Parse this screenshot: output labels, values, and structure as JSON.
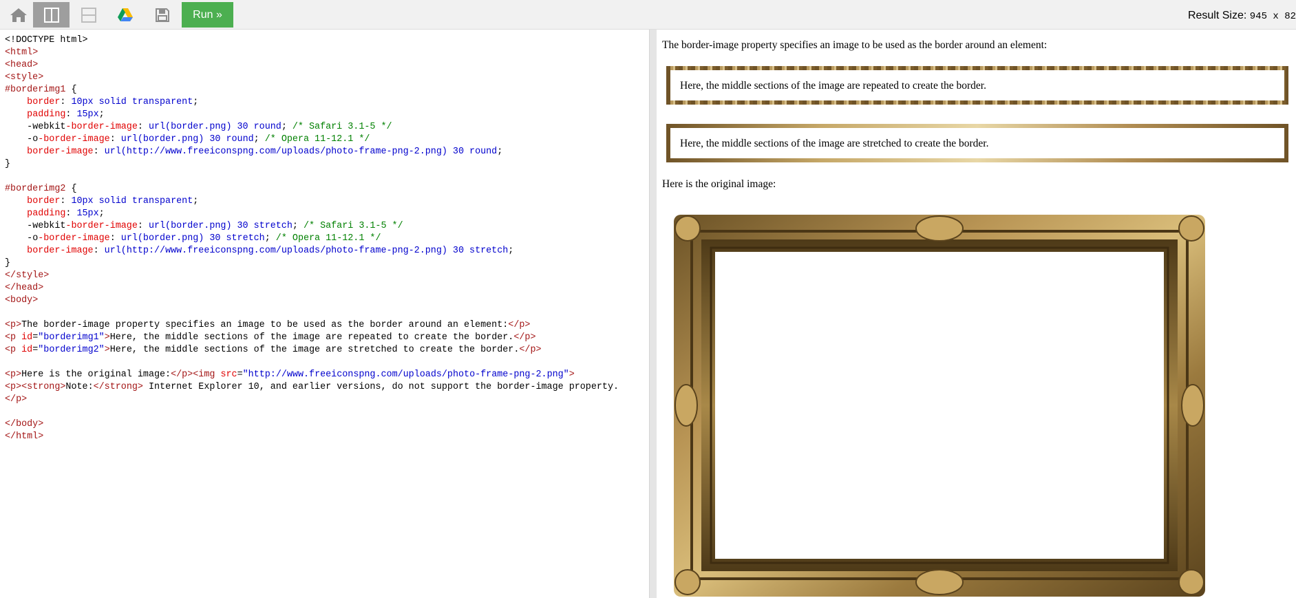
{
  "toolbar": {
    "home_icon": "home-icon",
    "layout_vertical_icon": "layout-vertical-icon",
    "layout_horizontal_icon": "layout-horizontal-icon",
    "drive_icon": "google-drive-icon",
    "save_icon": "save-icon",
    "run_label": "Run »",
    "result_size_label": "Result Size:",
    "result_size_value": "945 x 82"
  },
  "colors": {
    "run_button": "#4caf50",
    "toolbar_bg": "#f1f1f1",
    "tag": "#a31515",
    "property": "#e00000",
    "value": "#0000cd",
    "comment": "#008000"
  },
  "editor": {
    "lines": [
      "<!DOCTYPE html>",
      "<html>",
      "<head>",
      "<style>",
      "#borderimg1 {",
      "    border: 10px solid transparent;",
      "    padding: 15px;",
      "    -webkit-border-image: url(border.png) 30 round; /* Safari 3.1-5 */",
      "    -o-border-image: url(border.png) 30 round; /* Opera 11-12.1 */",
      "    border-image: url(http://www.freeiconspng.com/uploads/photo-frame-png-2.png) 30 round;",
      "}",
      "",
      "#borderimg2 {",
      "    border: 10px solid transparent;",
      "    padding: 15px;",
      "    -webkit-border-image: url(border.png) 30 stretch; /* Safari 3.1-5 */",
      "    -o-border-image: url(border.png) 30 stretch; /* Opera 11-12.1 */",
      "    border-image: url(http://www.freeiconspng.com/uploads/photo-frame-png-2.png) 30 stretch;",
      "}",
      "</style>",
      "</head>",
      "<body>",
      "",
      "<p>The border-image property specifies an image to be used as the border around an element:</p>",
      "<p id=\"borderimg1\">Here, the middle sections of the image are repeated to create the border.</p>",
      "<p id=\"borderimg2\">Here, the middle sections of the image are stretched to create the border.</p>",
      "",
      "<p>Here is the original image:</p><img src=\"http://www.freeiconspng.com/uploads/photo-frame-png-2.png\">",
      "<p><strong>Note:</strong> Internet Explorer 10, and earlier versions, do not support the border-image property.",
      "</p>",
      "",
      "</body>",
      "</html>"
    ]
  },
  "result": {
    "intro": "The border-image property specifies an image to be used as the border around an element:",
    "box1": "Here, the middle sections of the image are repeated to create the border.",
    "box2": "Here, the middle sections of the image are stretched to create the border.",
    "original_label": "Here is the original image:"
  }
}
